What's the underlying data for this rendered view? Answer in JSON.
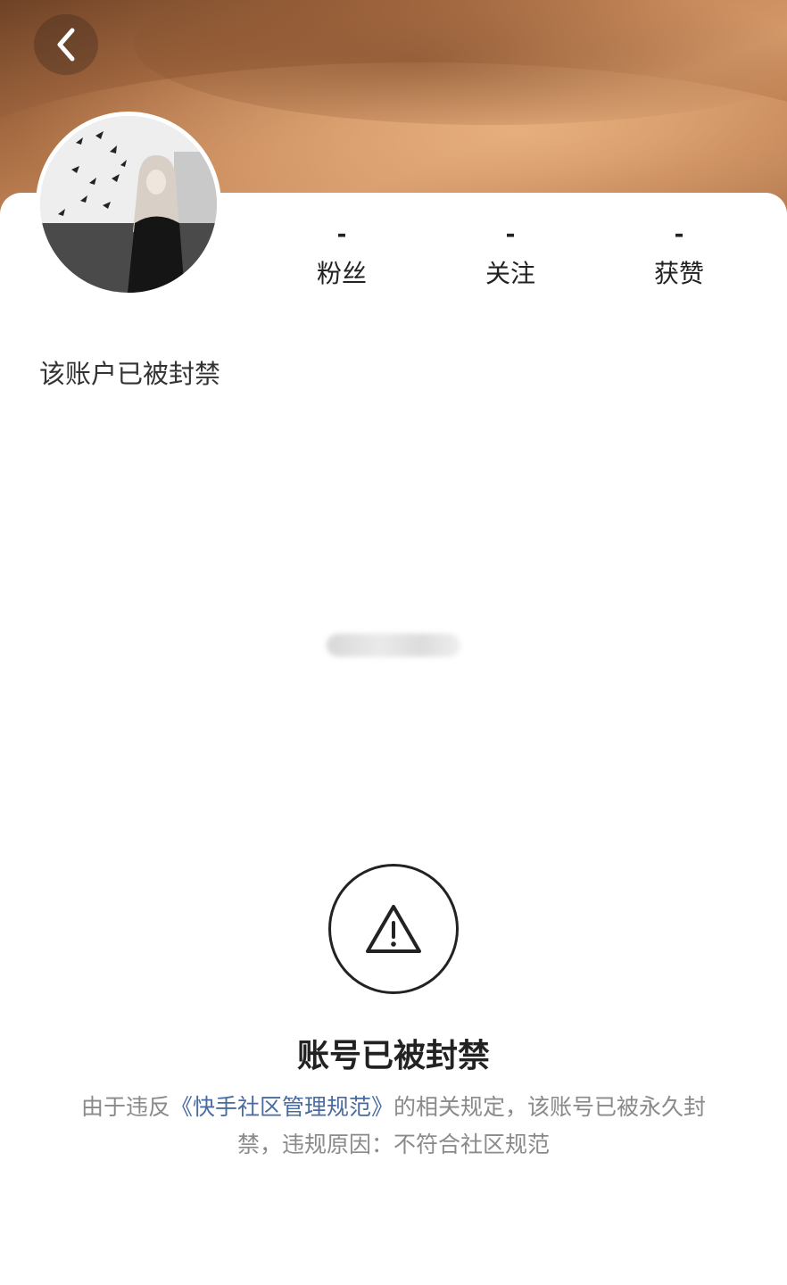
{
  "stats": [
    {
      "value": "-",
      "label": "粉丝"
    },
    {
      "value": "-",
      "label": "关注"
    },
    {
      "value": "-",
      "label": "获赞"
    }
  ],
  "profile": {
    "banned_note": "该账户已被封禁"
  },
  "ban_notice": {
    "title": "账号已被封禁",
    "desc_prefix": "由于违反",
    "desc_link": "《快手社区管理规范》",
    "desc_suffix": "的相关规定，该账号已被永久封禁，违规原因：不符合社区规范"
  },
  "icons": {
    "back": "chevron-left-icon",
    "warning": "warning-triangle-icon"
  },
  "colors": {
    "link": "#4a6ba0",
    "desc_text": "#8a8a8a",
    "cover_brown": "#b97a4c"
  }
}
